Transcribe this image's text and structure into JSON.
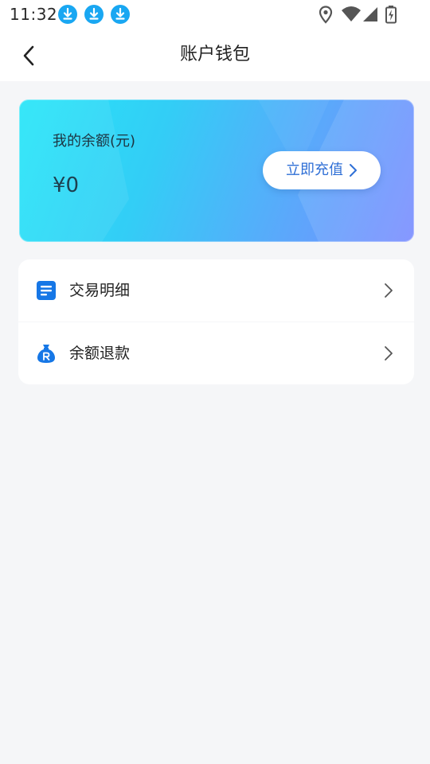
{
  "status_bar": {
    "time": "11:32",
    "notification_icons": [
      "download-icon",
      "download-icon",
      "download-icon"
    ],
    "right_icons": [
      "location-icon",
      "wifi-icon",
      "signal-icon",
      "battery-icon"
    ]
  },
  "nav": {
    "title": "账户钱包",
    "back_icon": "back-arrow-icon"
  },
  "balance_card": {
    "label": "我的余额(元)",
    "value": "¥0",
    "recharge_label": "立即充值"
  },
  "menu": {
    "items": [
      {
        "label": "交易明细",
        "icon": "document-icon"
      },
      {
        "label": "余额退款",
        "icon": "money-bag-icon"
      }
    ]
  },
  "colors": {
    "accent_blue": "#2f6fd6",
    "icon_blue": "#1677e6",
    "card_start": "#27e6f8",
    "card_end": "#7a8cff",
    "page_background": "#f5f6f8"
  }
}
